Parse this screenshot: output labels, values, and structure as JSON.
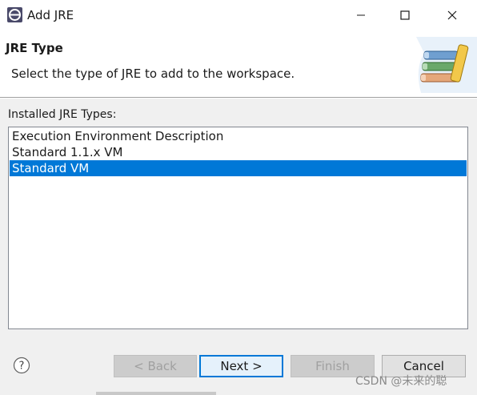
{
  "window": {
    "title": "Add JRE",
    "app_icon": "eclipse-icon",
    "controls": [
      "minimize-icon",
      "maximize-icon",
      "close-icon"
    ]
  },
  "banner": {
    "title": "JRE Type",
    "description": "Select the type of JRE to add to the workspace.",
    "image": "jre-books-icon"
  },
  "content": {
    "list_label": "Installed JRE Types:",
    "items": [
      {
        "label": "Execution Environment Description",
        "selected": false
      },
      {
        "label": "Standard 1.1.x VM",
        "selected": false
      },
      {
        "label": "Standard VM",
        "selected": true
      }
    ]
  },
  "buttons": {
    "help_icon": "help-icon",
    "back": "< Back",
    "next": "Next >",
    "finish": "Finish",
    "cancel": "Cancel"
  },
  "watermark": "CSDN @未来的聪",
  "colors": {
    "selection": "#0078d7",
    "default_button_border": "#0078d7",
    "dialog_bg": "#f0f0f0"
  }
}
